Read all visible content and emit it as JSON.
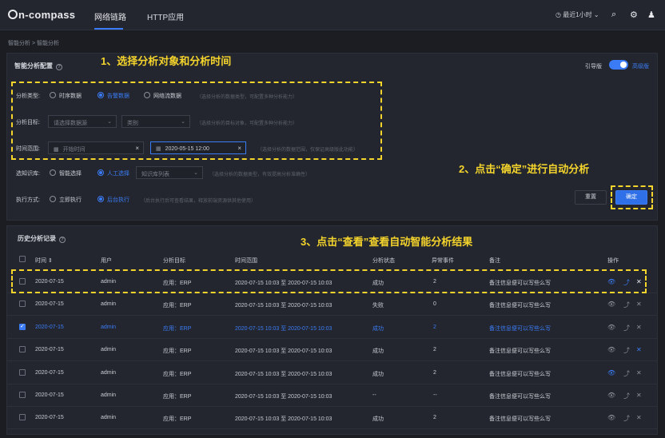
{
  "app": {
    "logo": "n-compass"
  },
  "nav": {
    "tabs": [
      "网络链路",
      "HTTP应用"
    ]
  },
  "header": {
    "time_range": "最近1小时 ⌄"
  },
  "breadcrumb": "智能分析 > 智能分析",
  "config_panel": {
    "title": "智能分析配置",
    "annotation": "1、选择分析对象和分析时间",
    "toggle_left": "引导版",
    "toggle_right": "高级版",
    "analysis_type": {
      "label": "分析类型:",
      "options": [
        "时序数据",
        "告警数据",
        "网络流数据"
      ],
      "selected": 1,
      "hint": "（选择分析的数据类型，可配置多种分析能力）"
    },
    "analysis_target": {
      "label": "分析目标:",
      "select1_placeholder": "请选择数据源",
      "select2_placeholder": "类别",
      "hint": "（选择分析的目标对象，可配置多种分析能力）"
    },
    "time_range": {
      "label": "时间范围:",
      "start_placeholder": "开始时间",
      "end_value": "2020-05-15 12:00",
      "hint": "（选择分析的数据范围，仅保证高级版此功能）"
    },
    "knowledge": {
      "label": "选知识库:",
      "options": [
        "智能选择",
        "人工选择"
      ],
      "selected": 1,
      "select_placeholder": "知识库列表",
      "hint": "（选择分析的数据类型，有效提高分析准确性）"
    },
    "exec_mode": {
      "label": "执行方式:",
      "options": [
        "立即执行",
        "后台执行"
      ],
      "selected": 1,
      "hint": "（后台执行后可查看结果，释放前端资源供其他使用）"
    },
    "annotation2": "2、点击“确定”进行自动分析",
    "reset_label": "重置",
    "ok_label": "确定"
  },
  "history_panel": {
    "title": "历史分析记录",
    "annotation": "3、点击“查看”查看自动智能分析结果",
    "columns": [
      "时间 ⇕",
      "用户",
      "分析目标",
      "时间范围",
      "分析状态",
      "异常事件",
      "备注",
      "操作"
    ],
    "rows": [
      {
        "time": "2020-07-15",
        "user": "admin",
        "target": "应用：ERP",
        "range": "2020-07-15 10:03 至 2020-07-15 10:03",
        "status": "成功",
        "events": "2",
        "note": "备注信息便可以写些么写",
        "checked": false,
        "selected": false
      },
      {
        "time": "2020-07-15",
        "user": "admin",
        "target": "应用：ERP",
        "range": "2020-07-15 10:03 至 2020-07-15 10:03",
        "status": "失败",
        "events": "0",
        "note": "备注信息便可以写些么写",
        "checked": false,
        "selected": false
      },
      {
        "time": "2020-07-15",
        "user": "admin",
        "target": "应用：ERP",
        "range": "2020-07-15 10:03 至 2020-07-15 10:03",
        "status": "成功",
        "events": "2",
        "note": "备注信息便可以写些么写",
        "checked": true,
        "selected": true
      },
      {
        "time": "2020-07-15",
        "user": "admin",
        "target": "应用：ERP",
        "range": "2020-07-15 10:03 至 2020-07-15 10:03",
        "status": "成功",
        "events": "2",
        "note": "备注信息便可以写些么写",
        "checked": false,
        "selected": false
      },
      {
        "time": "2020-07-15",
        "user": "admin",
        "target": "应用：ERP",
        "range": "2020-07-15 10:03 至 2020-07-15 10:03",
        "status": "成功",
        "events": "2",
        "note": "备注信息便可以写些么写",
        "checked": false,
        "selected": false
      },
      {
        "time": "2020-07-15",
        "user": "admin",
        "target": "应用：ERP",
        "range": "2020-07-15 10:03 至 2020-07-15 10:03",
        "status": "--",
        "events": "--",
        "note": "备注信息便可以写些么写",
        "checked": false,
        "selected": false
      },
      {
        "time": "2020-07-15",
        "user": "admin",
        "target": "应用：ERP",
        "range": "2020-07-15 10:03 至 2020-07-15 10:03",
        "status": "成功",
        "events": "2",
        "note": "备注信息便可以写些么写",
        "checked": false,
        "selected": false
      }
    ]
  },
  "colors": {
    "accent": "#3b7cf6",
    "annotation": "#f5d42c",
    "background": "#1b1d23",
    "panel": "#23262e"
  }
}
